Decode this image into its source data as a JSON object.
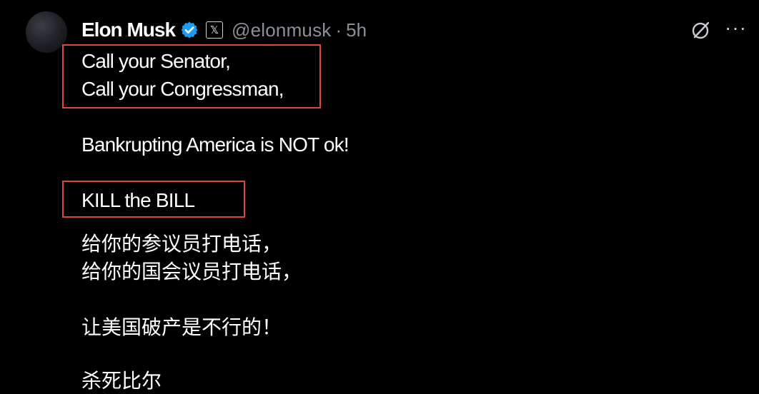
{
  "tweet": {
    "author": {
      "name": "Elon Musk",
      "handle": "@elonmusk",
      "separator": "·",
      "time": "5h",
      "affiliate_glyph": "𝕏"
    },
    "icons": {
      "avatar": "avatar",
      "verified": "verified-badge-icon",
      "affiliate": "x-affiliate-icon",
      "grok": "grok-icon",
      "more": "more-options-icon"
    },
    "more_glyph": "···",
    "lines": [
      "Call your Senator,",
      "Call your Congressman,",
      "Bankrupting America is NOT ok!",
      "KILL the BILL",
      "给你的参议员打电话，",
      "给你的国会议员打电话，",
      "让美国破产是不行的！",
      "杀死比尔"
    ]
  },
  "colors": {
    "background": "#000000",
    "text": "#ffffff",
    "secondary_text": "#8b9096",
    "verified_blue": "#1d9bf0",
    "highlight_red": "#e0463f"
  }
}
